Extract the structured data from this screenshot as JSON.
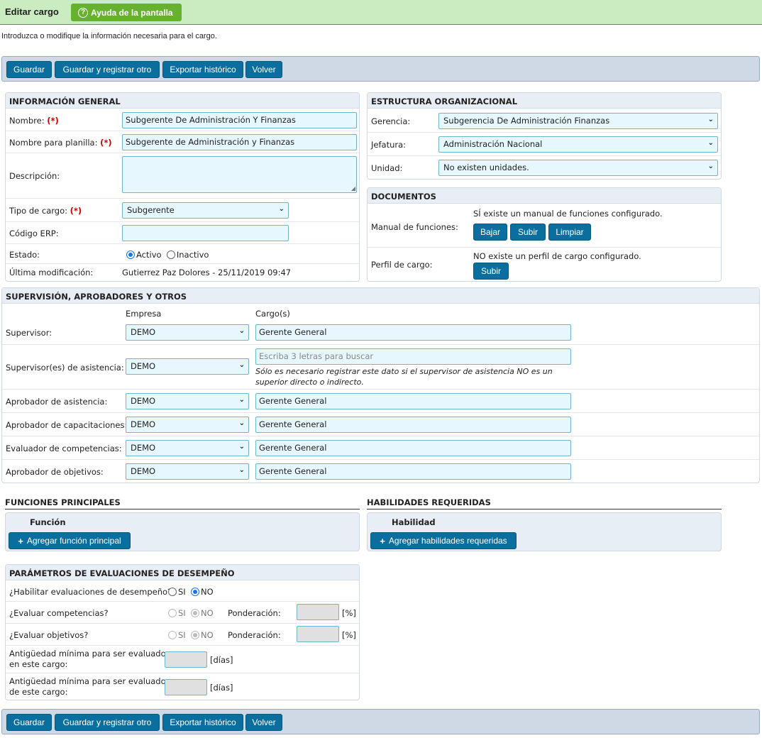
{
  "header": {
    "title": "Editar cargo",
    "help_label": "Ayuda de la pantalla"
  },
  "intro": "Introduzca o modifique la información necesaria para el cargo.",
  "toolbar": {
    "save": "Guardar",
    "save_new": "Guardar y registrar otro",
    "export": "Exportar histórico",
    "back": "Volver"
  },
  "general": {
    "title": "INFORMACIÓN GENERAL",
    "required_mark": "(*)",
    "nombre_label": "Nombre:",
    "nombre_value": "Subgerente De Administración Y Finanzas",
    "planilla_label": "Nombre para planilla:",
    "planilla_value": "Subgerente de Administración y Finanzas",
    "descripcion_label": "Descripción:",
    "tipo_label": "Tipo de cargo:",
    "tipo_value": "Subgerente",
    "erp_label": "Código ERP:",
    "estado_label": "Estado:",
    "activo": "Activo",
    "inactivo": "Inactivo",
    "ultima_label": "Última modificación:",
    "ultima_value": "Gutierrez Paz Dolores - 25/11/2019 09:47"
  },
  "estructura": {
    "title": "ESTRUCTURA ORGANIZACIONAL",
    "gerencia_label": "Gerencia:",
    "gerencia_value": "Subgerencia De Administración Finanzas",
    "jefatura_label": "Jefatura:",
    "jefatura_value": "Administración Nacional",
    "unidad_label": "Unidad:",
    "unidad_value": "No existen unidades."
  },
  "documentos": {
    "title": "DOCUMENTOS",
    "manual_label": "Manual de funciones:",
    "manual_status": "SÍ existe un manual de funciones configurado.",
    "bajar": "Bajar",
    "subir": "Subir",
    "limpiar": "Limpiar",
    "perfil_label": "Perfil de cargo:",
    "perfil_status": "NO existe un perfil de cargo configurado.",
    "perfil_subir": "Subir"
  },
  "supervision": {
    "title": "SUPERVISIÓN, APROBADORES Y OTROS",
    "col_empresa": "Empresa",
    "col_cargo": "Cargo(s)",
    "rows": [
      {
        "label": "Supervisor:",
        "empresa": "DEMO",
        "cargo": "Gerente General"
      },
      {
        "label": "Supervisor(es) de asistencia:",
        "empresa": "DEMO",
        "placeholder": "Escriba 3 letras para buscar",
        "note": "Sólo es necesario registrar este dato si el supervisor de asistencia NO es un superior directo o indirecto."
      },
      {
        "label": "Aprobador de asistencia:",
        "empresa": "DEMO",
        "cargo": "Gerente General"
      },
      {
        "label": "Aprobador de capacitaciones:",
        "empresa": "DEMO",
        "cargo": "Gerente General"
      },
      {
        "label": "Evaluador de competencias:",
        "empresa": "DEMO",
        "cargo": "Gerente General"
      },
      {
        "label": "Aprobador de objetivos:",
        "empresa": "DEMO",
        "cargo": "Gerente General"
      }
    ]
  },
  "funciones": {
    "title": "FUNCIONES PRINCIPALES",
    "col": "Función",
    "add": "Agregar función principal"
  },
  "habilidades": {
    "title": "HABILIDADES REQUERIDAS",
    "col": "Habilidad",
    "add": "Agregar habilidades requeridas"
  },
  "evaluaciones": {
    "title": "PARÁMETROS DE EVALUACIONES DE DESEMPEÑO",
    "habilitar_label": "¿Habilitar evaluaciones de desempeño?",
    "competencias_label": "¿Evaluar competencias?",
    "objetivos_label": "¿Evaluar objetivos?",
    "si": "SI",
    "no": "NO",
    "ponderacion": "Ponderación:",
    "pct": "[%]",
    "antig_eval_1": "Antigüedad mínima para ser evaluado",
    "antig_eval_2": "en este cargo:",
    "antig_evaluador_1": "Antigüedad mínima para ser evaluador",
    "antig_evaluador_2": "de este cargo:",
    "dias": "[días]"
  }
}
